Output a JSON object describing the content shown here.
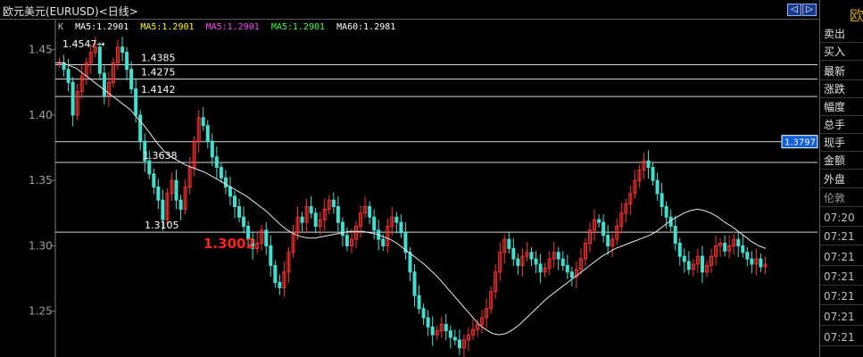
{
  "window": {
    "title": "欧元美元(EURUSD)<日线>",
    "nav_prev_icon": "◁",
    "nav_next_icon": "▷"
  },
  "legend": {
    "k": "K",
    "ma5_a": "MA5:1.2901",
    "ma5_b": "MA5:1.2901",
    "ma5_c": "MA5:1.2901",
    "ma5_d": "MA5:1.2901",
    "ma60": "MA60:1.2981",
    "colors": {
      "k": "#c0c0c0",
      "ma5_a": "#ffffff",
      "ma5_b": "#ffff00",
      "ma5_c": "#ff40ff",
      "ma5_d": "#40ff40",
      "ma60": "#ffffff"
    }
  },
  "side_panel": {
    "title_char": "欧",
    "items": [
      "卖出",
      "买入",
      "最新",
      "涨跌",
      "幅度",
      "总手",
      "现手",
      "金额",
      "外盘",
      "伦敦"
    ],
    "times": [
      "07:20",
      "07:21",
      "07:21",
      "07:21",
      "07:21",
      "07:21",
      "07:21"
    ]
  },
  "chart_data": {
    "type": "candlestick",
    "ylim": [
      1.215,
      1.473
    ],
    "y_ticks": [
      "1.45",
      "1.40",
      "1.35",
      "1.30",
      "1.25"
    ],
    "grid": false,
    "levels": [
      {
        "value": 1.4385,
        "label": "1.4385"
      },
      {
        "value": 1.4275,
        "label": "1.4275"
      },
      {
        "value": 1.4142,
        "label": "1.4142"
      },
      {
        "value": 1.3638,
        "label": "1.3638"
      },
      {
        "value": 1.3105,
        "label": "1.3105"
      },
      {
        "value": 1.3797,
        "label": "1.3797",
        "price_tag": true
      }
    ],
    "annotations": [
      {
        "text": "1.4547",
        "value": 1.4547
      },
      {
        "text": "1.3002",
        "value": 1.3002,
        "color": "#ff2020"
      }
    ],
    "close_series": [
      1.44,
      1.435,
      1.425,
      1.4,
      1.418,
      1.43,
      1.44,
      1.448,
      1.452,
      1.432,
      1.415,
      1.425,
      1.44,
      1.452,
      1.448,
      1.435,
      1.42,
      1.4,
      1.38,
      1.365,
      1.355,
      1.345,
      1.335,
      1.32,
      1.34,
      1.35,
      1.335,
      1.328,
      1.345,
      1.36,
      1.38,
      1.398,
      1.392,
      1.38,
      1.368,
      1.36,
      1.352,
      1.345,
      1.338,
      1.33,
      1.322,
      1.315,
      1.305,
      1.298,
      1.302,
      1.312,
      1.3,
      1.285,
      1.272,
      1.268,
      1.28,
      1.295,
      1.31,
      1.322,
      1.318,
      1.33,
      1.325,
      1.315,
      1.32,
      1.328,
      1.335,
      1.33,
      1.318,
      1.308,
      1.3,
      1.305,
      1.315,
      1.325,
      1.33,
      1.322,
      1.312,
      1.305,
      1.3,
      1.315,
      1.322,
      1.318,
      1.31,
      1.295,
      1.28,
      1.262,
      1.252,
      1.245,
      1.238,
      1.232,
      1.235,
      1.24,
      1.235,
      1.23,
      1.228,
      1.222,
      1.228,
      1.232,
      1.236,
      1.24,
      1.245,
      1.252,
      1.265,
      1.28,
      1.295,
      1.305,
      1.298,
      1.29,
      1.285,
      1.292,
      1.295,
      1.29,
      1.286,
      1.28,
      1.283,
      1.29,
      1.295,
      1.29,
      1.285,
      1.28,
      1.276,
      1.282,
      1.29,
      1.302,
      1.312,
      1.32,
      1.318,
      1.308,
      1.3,
      1.305,
      1.315,
      1.325,
      1.332,
      1.34,
      1.35,
      1.358,
      1.365,
      1.36,
      1.35,
      1.34,
      1.33,
      1.322,
      1.315,
      1.302,
      1.292,
      1.288,
      1.282,
      1.286,
      1.292,
      1.28,
      1.285,
      1.292,
      1.3,
      1.302,
      1.296,
      1.3,
      1.305,
      1.3,
      1.295,
      1.29,
      1.286,
      1.29,
      1.284,
      1.286
    ],
    "ma_series": [
      1.44,
      1.44,
      1.438,
      1.436,
      1.432,
      1.428,
      1.424,
      1.42,
      1.416,
      1.412,
      1.408,
      1.404,
      1.398,
      1.392,
      1.385,
      1.378,
      1.372,
      1.368,
      1.365,
      1.362,
      1.36,
      1.358,
      1.356,
      1.353,
      1.35,
      1.347,
      1.344,
      1.341,
      1.338,
      1.334,
      1.33,
      1.326,
      1.321,
      1.316,
      1.312,
      1.309,
      1.307,
      1.306,
      1.306,
      1.307,
      1.308,
      1.309,
      1.31,
      1.311,
      1.311,
      1.311,
      1.31,
      1.309,
      1.307,
      1.305,
      1.302,
      1.298,
      1.294,
      1.29,
      1.286,
      1.281,
      1.276,
      1.27,
      1.264,
      1.258,
      1.252,
      1.246,
      1.24,
      1.236,
      1.233,
      1.232,
      1.233,
      1.236,
      1.24,
      1.245,
      1.25,
      1.255,
      1.26,
      1.264,
      1.268,
      1.272,
      1.276,
      1.28,
      1.284,
      1.288,
      1.292,
      1.295,
      1.298,
      1.3,
      1.302,
      1.304,
      1.306,
      1.308,
      1.311,
      1.315,
      1.319,
      1.322,
      1.325,
      1.327,
      1.328,
      1.327,
      1.325,
      1.322,
      1.318,
      1.315,
      1.311,
      1.307,
      1.303,
      1.3,
      1.298
    ],
    "price_labels": [
      {
        "value": 1.45,
        "text": "1.45"
      },
      {
        "value": 1.4,
        "text": "1.40"
      },
      {
        "value": 1.35,
        "text": "1.35"
      },
      {
        "value": 1.3,
        "text": "1.30"
      },
      {
        "value": 1.25,
        "text": "1.25"
      }
    ],
    "right_value": {
      "text": "1.3797",
      "value": 1.3797
    }
  }
}
